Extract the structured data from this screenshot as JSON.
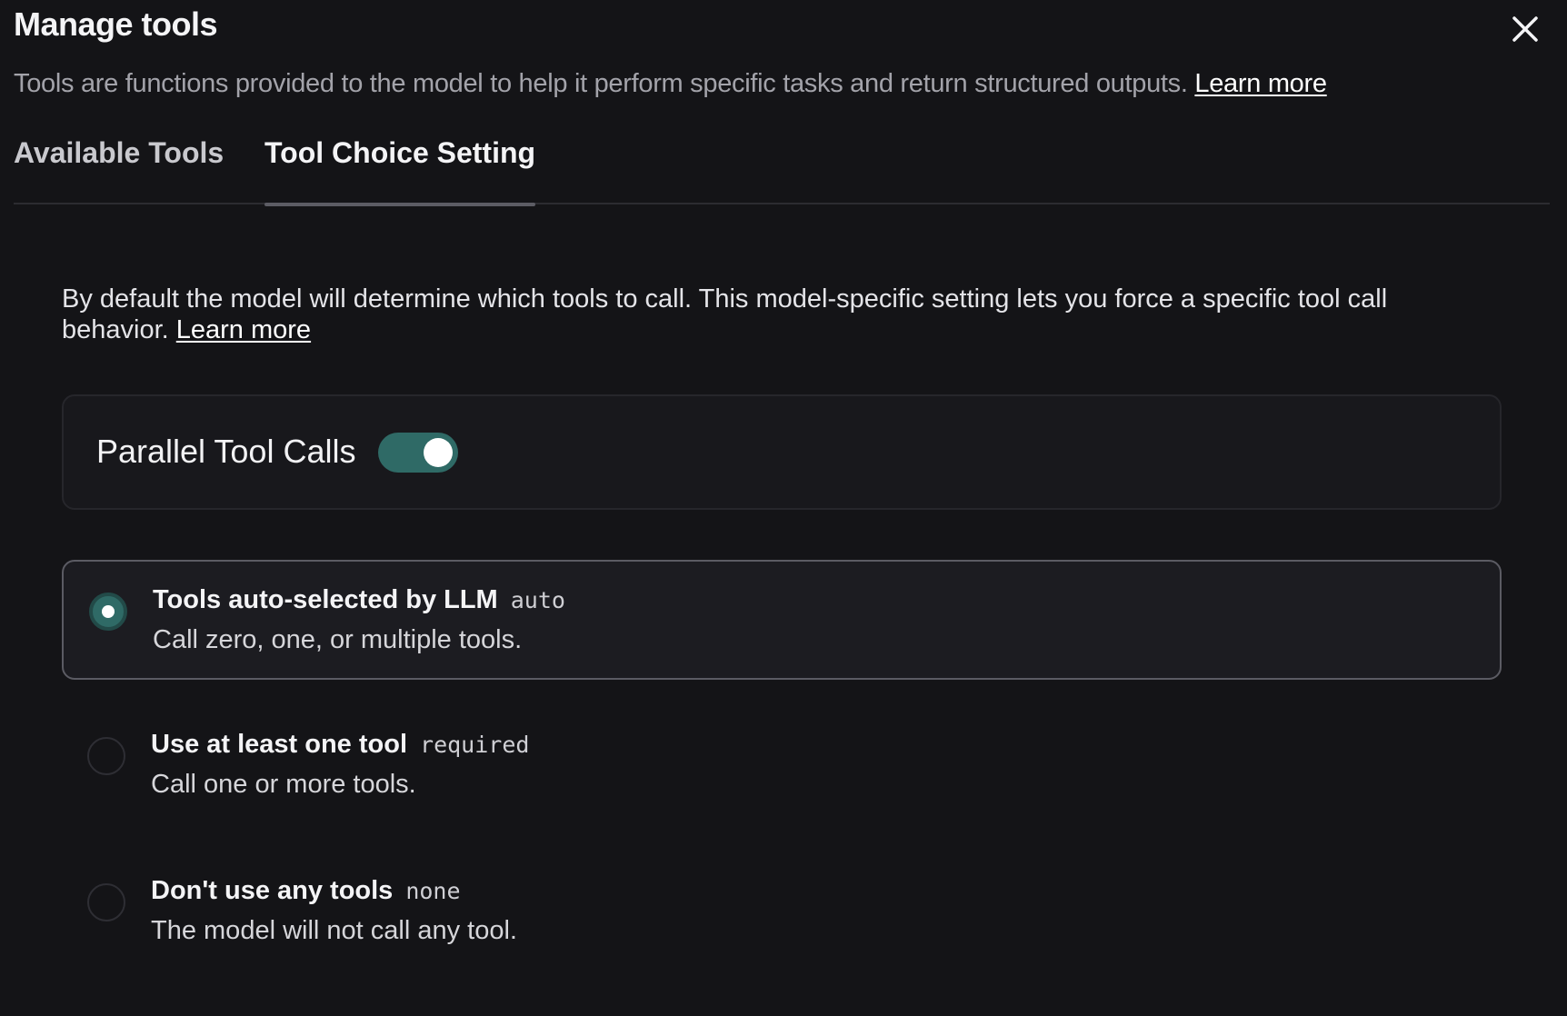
{
  "dialog": {
    "title": "Manage tools",
    "subtitle": "Tools are functions provided to the model to help it perform specific tasks and return structured outputs.",
    "subtitle_link": "Learn more",
    "close_icon": "close-icon"
  },
  "tabs": [
    {
      "label": "Available Tools",
      "active": false
    },
    {
      "label": "Tool Choice Setting",
      "active": true
    }
  ],
  "settings": {
    "description": "By default the model will determine which tools to call. This model-specific setting lets you force a specific tool call behavior.",
    "description_link": "Learn more",
    "parallel_label": "Parallel Tool Calls",
    "parallel_enabled": true,
    "options": [
      {
        "title": "Tools auto-selected by LLM",
        "code": "auto",
        "description": "Call zero, one, or multiple tools.",
        "selected": true
      },
      {
        "title": "Use at least one tool",
        "code": "required",
        "description": "Call one or more tools.",
        "selected": false
      },
      {
        "title": "Don't use any tools",
        "code": "none",
        "description": "The model will not call any tool.",
        "selected": false
      }
    ]
  },
  "colors": {
    "background": "#141417",
    "accent": "#2f6a66",
    "muted_text": "#a3a3aa"
  }
}
